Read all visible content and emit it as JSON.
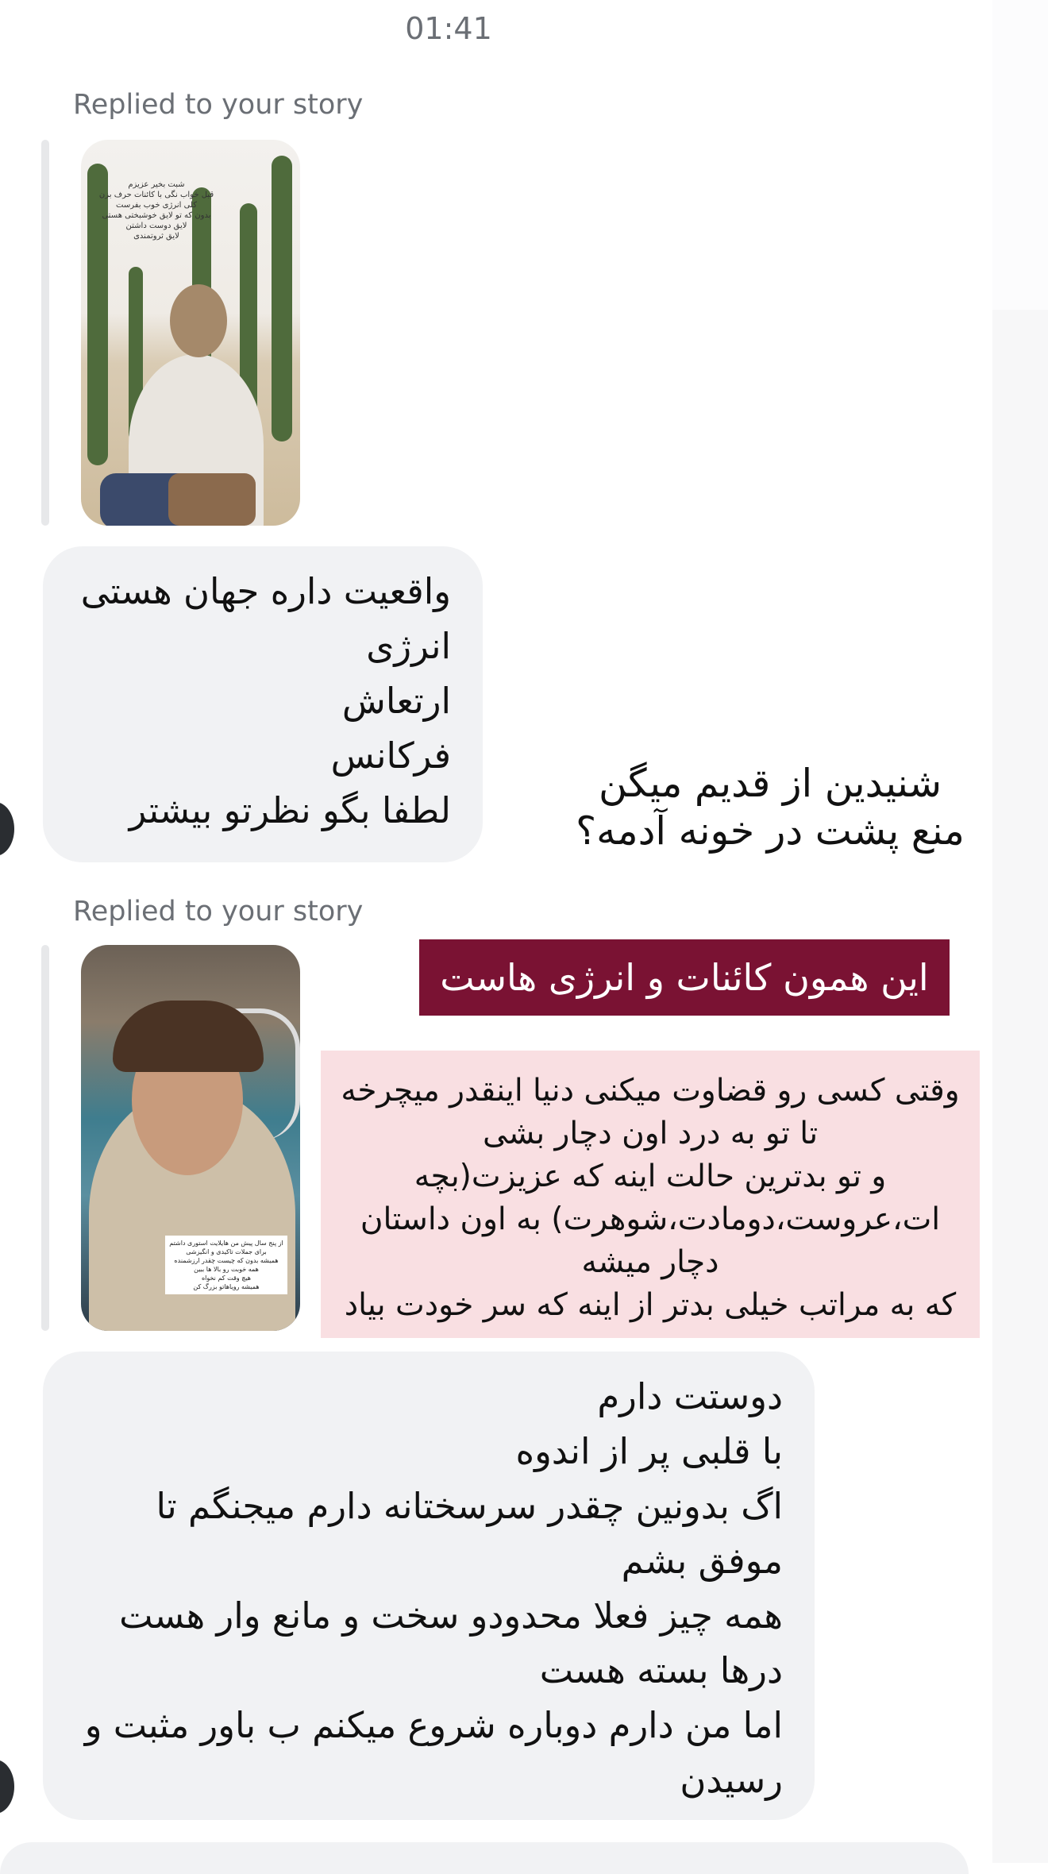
{
  "header": {
    "timestamp": "01:41"
  },
  "thread": {
    "reply1": {
      "label": "Replied to your story",
      "story_text": [
        "شبت بخیر عزیزم",
        "قبل خواب نگی با کائنات حرف بزن",
        "کلی انرژی خوب بفرست",
        "بدون که تو لایق خوشبختی هستی",
        "لایق دوست داشتن",
        "لایق ثروتمندی"
      ],
      "overlay_text": [
        "شنیدین از قدیم میگن",
        "منع پشت در خونه آدمه؟"
      ]
    },
    "message1": {
      "lines": [
        "واقعیت داره جهان هستی",
        "انرژی",
        "ارتعاش",
        "فرکانس",
        "لطفا بگو نظرتو بیشتر"
      ]
    },
    "reply2": {
      "label": "Replied to your story",
      "maroon_text": "این همون کائنات و انرژی هاست",
      "pink_lines": [
        "وقتی کسی رو قضاوت میکنی دنیا اینقدر میچرخه",
        "تا تو به درد اون دچار بشی",
        "و تو بدترین حالت اینه که عزیزت(بچه",
        "ات،عروست،دومادت،شوهرت) به اون داستان",
        "دچار میشه",
        "که به مراتب خیلی بدتر از اینه که سر خودت بیاد"
      ],
      "story_caption": [
        "از پنج سال پیش من هایلایت استوری داشتم",
        "برای جملات تاکیدی و انگیزشی",
        "همیشه بدون که چیست چقدر ارزشمنده",
        "همه خوبت رو بالا ها ببین",
        "هیچ وقت کم نخواه",
        "همیشه رویاهاتو بزرگ کن"
      ]
    },
    "message2": {
      "lines": [
        "دوستت دارم",
        "با قلبی پر از اندوه",
        "اگ بدونین چقدر سرسختانه دارم میجنگم تا",
        "موفق بشم",
        "همه چیز فعلا محدودو سخت و مانع وار هست",
        "درها بسته هست",
        "اما من دارم دوباره شروع میکنم ب باور مثبت و",
        "رسیدن"
      ]
    }
  }
}
